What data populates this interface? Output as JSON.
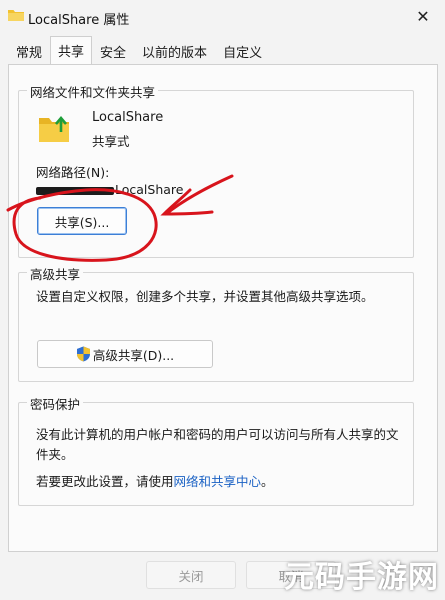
{
  "window": {
    "title": "LocalShare 属性",
    "close_glyph": "✕"
  },
  "tabs": [
    {
      "label": "常规",
      "active": false
    },
    {
      "label": "共享",
      "active": true
    },
    {
      "label": "安全",
      "active": false
    },
    {
      "label": "以前的版本",
      "active": false
    },
    {
      "label": "自定义",
      "active": false
    }
  ],
  "network_share": {
    "group_label": "网络文件和文件夹共享",
    "folder_name": "LocalShare",
    "status": "共享式",
    "path_label": "网络路径(N):",
    "path_value_visible": "LocalShare",
    "share_button": "共享(S)..."
  },
  "advanced_share": {
    "group_label": "高级共享",
    "description": "设置自定义权限，创建多个共享，并设置其他高级共享选项。",
    "button": "高级共享(D)..."
  },
  "password_protection": {
    "group_label": "密码保护",
    "line1": "没有此计算机的用户帐户和密码的用户可以访问与所有人共享的文",
    "line2": "件夹。",
    "change_prefix": "若要更改此设置，请使用",
    "link": "网络和共享中心",
    "change_suffix": "。"
  },
  "footer": {
    "close_button": "关闭",
    "cancel_button": "取消"
  },
  "watermark": "元码手游网",
  "icons": {
    "folder": "shared-folder-icon",
    "shield": "uac-shield-icon",
    "close": "close-icon"
  },
  "colors": {
    "annotation_red": "#d8141c",
    "link_blue": "#1b62c4",
    "folder_yellow": "#f2c230"
  }
}
